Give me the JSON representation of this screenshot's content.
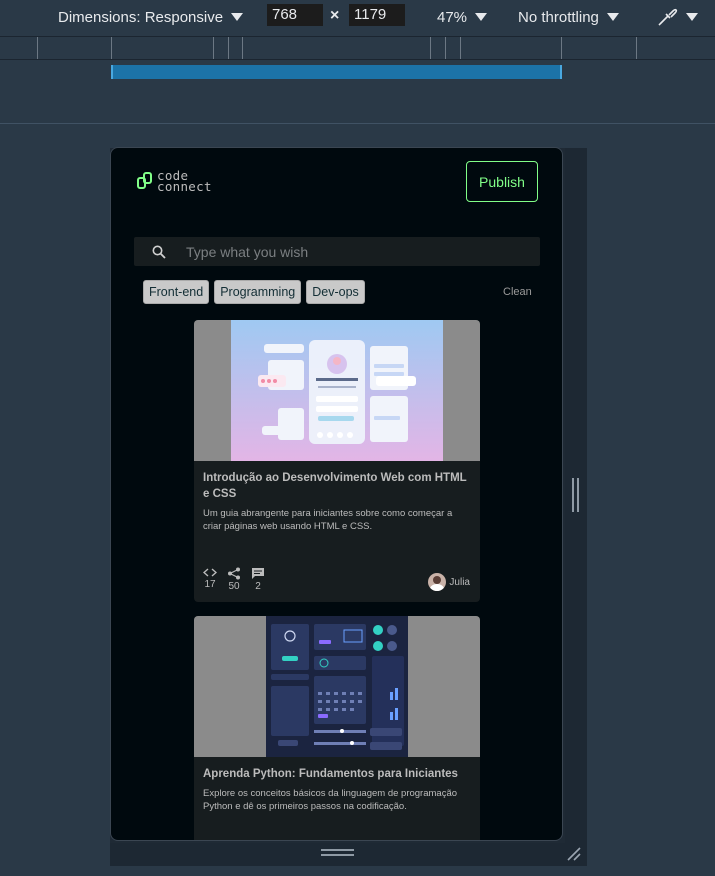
{
  "devtools": {
    "dimensions_label": "Dimensions: Responsive",
    "width_value": "768",
    "height_value": "1179",
    "times": "×",
    "zoom": "47%",
    "throttling": "No throttling"
  },
  "app": {
    "logo_line1": "code",
    "logo_line2": "connect",
    "publish_label": "Publish",
    "search_placeholder": "Type what you wish",
    "tags": [
      "Front-end",
      "Programming",
      "Dev-ops"
    ],
    "clean_label": "Clean",
    "accent_color": "#81fe88",
    "background_color": "#00090e"
  },
  "cards": [
    {
      "title": "Introdução ao Desenvolvimento Web com HTML e CSS",
      "description": "Um guia abrangente para iniciantes sobre como começar a criar páginas web usando HTML e CSS.",
      "code_count": "17",
      "share_count": "50",
      "comment_count": "2",
      "author": "Julia"
    },
    {
      "title": "Aprenda Python: Fundamentos para Iniciantes",
      "description": "Explore os conceitos básicos da linguagem de programação Python e dê os primeiros passos na codificação."
    }
  ]
}
